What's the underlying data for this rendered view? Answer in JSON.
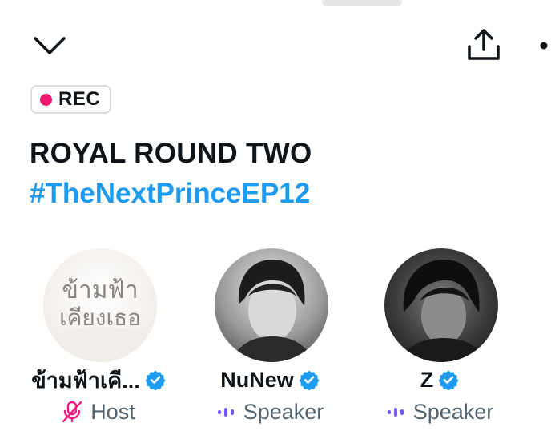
{
  "header": {
    "icons": {
      "collapse": "chevron-down-icon",
      "share": "share-icon",
      "more": "more-icon"
    }
  },
  "rec_badge": {
    "label": "REC",
    "dot_color": "#f0186f"
  },
  "space": {
    "title": "ROYAL ROUND TWO",
    "hashtag": "#TheNextPrinceEP12",
    "hashtag_color": "#1d9bf0"
  },
  "participants": [
    {
      "name": "ข้ามฟ้าเคี...",
      "verified": true,
      "role": "Host",
      "role_icon": "mic-muted-icon",
      "avatar_text": "ข้ามฟ้า\nเคียงเธอ"
    },
    {
      "name": "NuNew",
      "verified": true,
      "role": "Speaker",
      "role_icon": "speaker-bars-icon"
    },
    {
      "name": "Z",
      "verified": true,
      "role": "Speaker",
      "role_icon": "speaker-bars-icon"
    }
  ],
  "colors": {
    "verified_badge": "#1d9bf0",
    "role_icon": "#7856ff",
    "host_icon": "#f91880",
    "secondary_text": "#536471"
  }
}
